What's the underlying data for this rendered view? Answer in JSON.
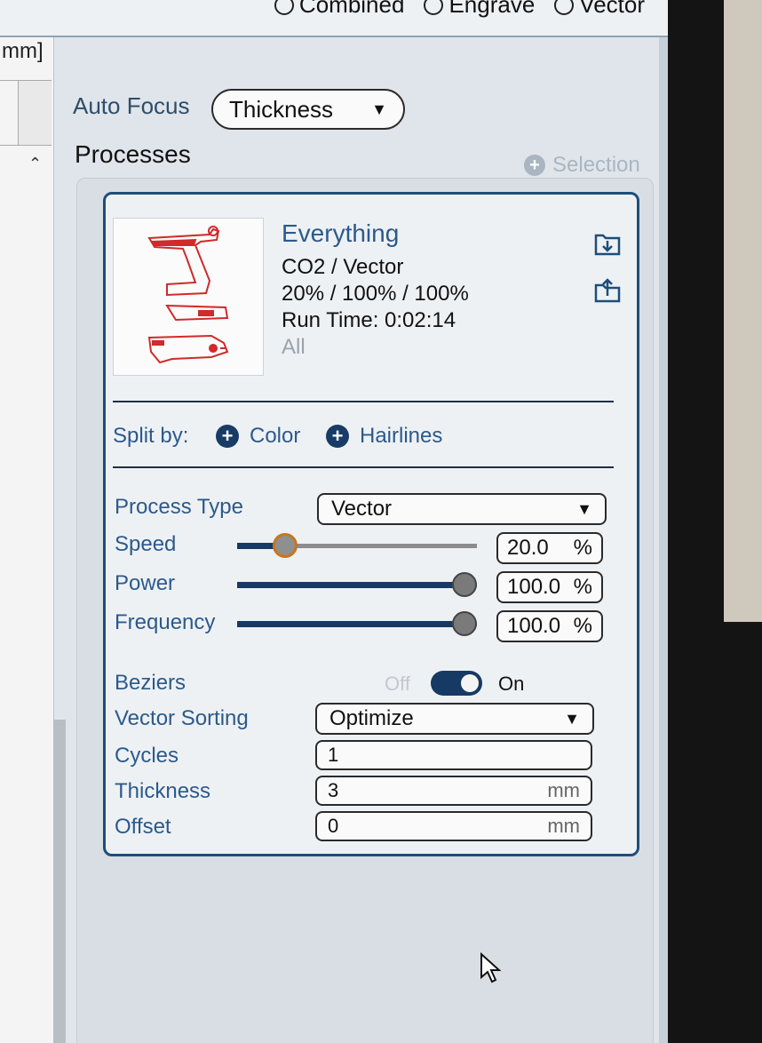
{
  "top_radios": [
    "Combined",
    "Engrave",
    "Vector"
  ],
  "left_pane": {
    "unit_label": "mm]"
  },
  "auto_focus": {
    "label": "Auto Focus",
    "value": "Thickness"
  },
  "processes": {
    "title": "Processes",
    "selection_button": "Selection",
    "card": {
      "name": "Everything",
      "laser_type": "CO2 / Vector",
      "settings_summary": "20% / 100% / 100%",
      "run_time": "Run Time: 0:02:14",
      "scope": "All"
    },
    "split_by": {
      "label": "Split by:",
      "options": [
        "Color",
        "Hairlines"
      ]
    },
    "process_type": {
      "label": "Process Type",
      "value": "Vector"
    },
    "speed": {
      "label": "Speed",
      "value": "20.0",
      "unit": "%",
      "level": 0.2
    },
    "power": {
      "label": "Power",
      "value": "100.0",
      "unit": "%",
      "level": 1.0
    },
    "frequency": {
      "label": "Frequency",
      "value": "100.0",
      "unit": "%",
      "level": 1.0
    },
    "beziers": {
      "label": "Beziers",
      "off_label": "Off",
      "on_label": "On",
      "state": "on"
    },
    "vector_sorting": {
      "label": "Vector Sorting",
      "value": "Optimize"
    },
    "cycles": {
      "label": "Cycles",
      "value": "1"
    },
    "thickness": {
      "label": "Thickness",
      "value": "3",
      "unit": "mm"
    },
    "offset": {
      "label": "Offset",
      "value": "0",
      "unit": "mm"
    }
  },
  "colors": {
    "accent_dark": "#163a63",
    "label_blue": "#2b5a8c",
    "slider_knob_highlight": "#c8761b",
    "thumbnail_lines": "#d02a2a"
  }
}
